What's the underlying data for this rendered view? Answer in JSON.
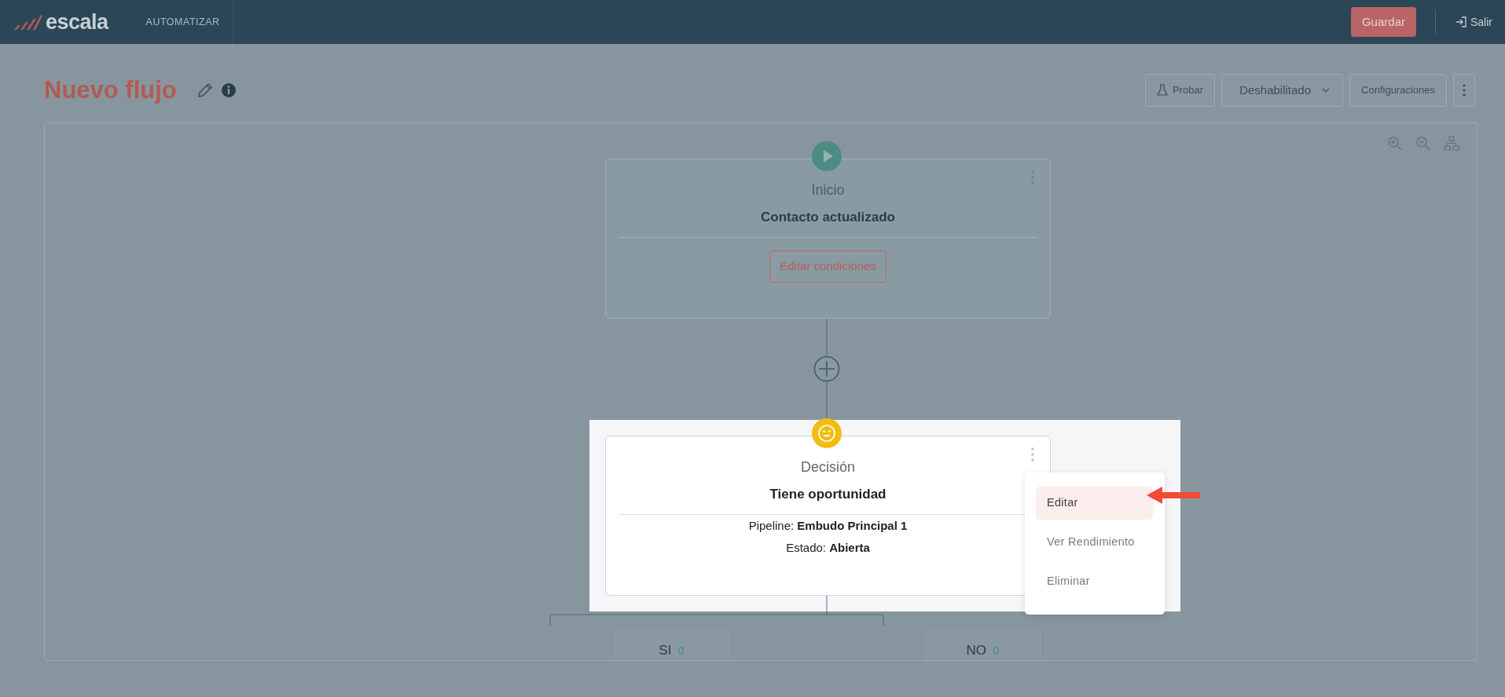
{
  "topbar": {
    "logo": "escala",
    "section": "AUTOMATIZAR",
    "save_button": "Guardar",
    "logout": "Salir"
  },
  "header": {
    "title": "Nuevo flujo",
    "buttons": [
      {
        "label": "Probar",
        "kind": "test"
      },
      {
        "label": "Deshabilitado",
        "kind": "dropdown"
      },
      {
        "label": "Configuraciones",
        "kind": "plain"
      }
    ]
  },
  "nodes": [
    {
      "kind": "start",
      "type_label": "Inicio",
      "title": "Contacto actualizado",
      "action": "Editar condiciones",
      "highlighted": false
    },
    {
      "kind": "decision",
      "type_label": "Decisión",
      "title": "Tiene oportunidad",
      "fields": [
        {
          "label": "Pipeline:",
          "value": "Embudo Principal 1"
        },
        {
          "label": "Estado:",
          "value": "Abierta"
        }
      ],
      "highlighted": true
    }
  ],
  "branches": [
    {
      "label": "SI",
      "count": "0"
    },
    {
      "label": "NO",
      "count": "0"
    }
  ],
  "context_menu": {
    "items": [
      {
        "label": "Editar",
        "selected": true
      },
      {
        "label": "Ver Rendimiento",
        "selected": false
      },
      {
        "label": "Eliminar",
        "selected": false
      }
    ]
  }
}
